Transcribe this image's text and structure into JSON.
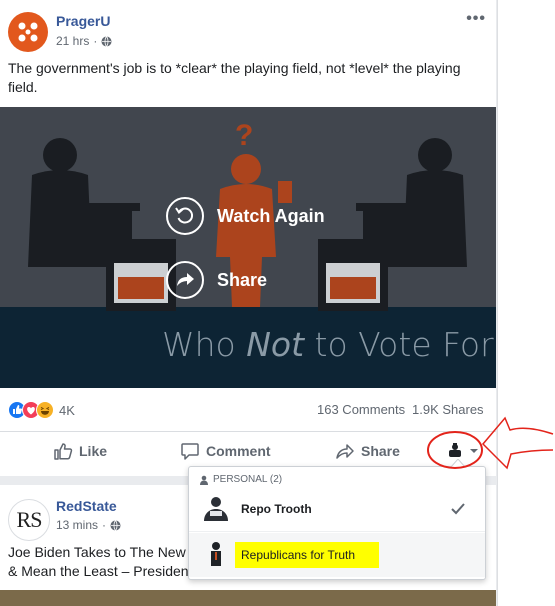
{
  "post1": {
    "author": "PragerU",
    "time": "21 hrs",
    "text": "The government's job is to *clear* the playing field, not *level* the playing field.",
    "video": {
      "watch_again_label": "Watch Again",
      "share_label": "Share",
      "title_pre": "Who ",
      "title_em": "Not",
      "title_post": " to Vote For"
    },
    "reactions_count": "4K",
    "comments": "163 Comments",
    "shares": "1.9K Shares",
    "actions": {
      "like": "Like",
      "comment": "Comment",
      "share": "Share"
    }
  },
  "dropdown": {
    "section_label": "PERSONAL (2)",
    "items": [
      {
        "name": "Repo Trooth",
        "selected": true
      },
      {
        "name": "Republicans for Truth",
        "highlighted": true
      }
    ]
  },
  "post2": {
    "author": "RedState",
    "time": "13 mins",
    "logo_text": "RS",
    "text_line1": "Joe Biden Takes to The New",
    "text_line2": "& Mean the Least – Presiden"
  },
  "colors": {
    "link_blue": "#385898",
    "pragerU_orange": "#e2581d",
    "highlight_yellow": "#ffff00",
    "annotation_red": "#e3241b"
  }
}
